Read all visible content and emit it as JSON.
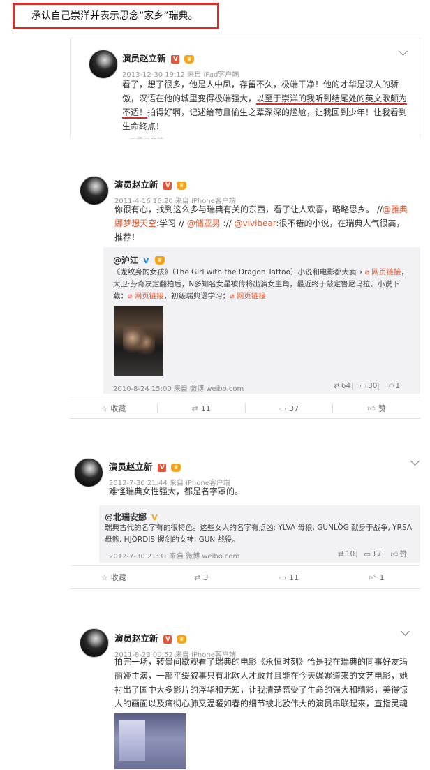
{
  "caption": "承认自己崇洋并表示思念“家乡”瑞典。",
  "icons": {
    "vip": "V",
    "crown": "vip-crown-icon",
    "verified_blue": "V",
    "chevron": "chevron-down-icon",
    "retweet": "retweet-icon",
    "comment": "comment-icon",
    "like": "like-icon",
    "star": "star-icon"
  },
  "posts": [
    {
      "name": "演员赵立新",
      "meta": "2013-12-30 19:12 来自 iPad客户端",
      "text_a": "看了，想了很多，他是人中凤，存留不久，极端干净！他的才华是汉人的骄傲，汉语在他的城里变得极端强大，",
      "text_b": "以至于崇洋的我听到结尾处的英文歌颇为不适！",
      "text_c": "拍得好啊，记述给苟且偷生之辈深深的尴尬，让我回到少年！让我看到生命终点！",
      "cutoff": "一二零四牟盹"
    },
    {
      "name": "演员赵立新",
      "meta": "2011-4-16 16:20 来自 iPhone客户端",
      "text_a": "你很有心，找到这么多与瑞典有关的东西，看了让人欢喜，略略思乡。 //",
      "mention1": "@雅典娜梦想天空",
      "text_b": ":学习 // ",
      "mention2": "@储亚男",
      "text_c": " :// ",
      "mention3": "@vivibear",
      "text_d": ":很不错的小说，在瑞典人气很高，推荐！",
      "repost": {
        "name": "@沪江",
        "text_a": "《龙纹身的女孩》（The Girl with the Dragon Tattoo）小说和电影都大卖→ ",
        "link1": "网页链接",
        "text_b": "，大卫·芬奇决定翻拍后，N多知名女星被传将出演女主角，最近终于敲定鲁尼玛拉。小说下载：",
        "link2": "网页链接",
        "text_c": "，初级瑞典语学习：",
        "link3": "网页链接",
        "footer": "2010-8-24 15:00 来自 微博 weibo.com",
        "reposts": "64",
        "comments": "30",
        "likes": "1"
      },
      "actions": {
        "fav": "收藏",
        "retweet": "11",
        "comment": "37",
        "like": "赞"
      }
    },
    {
      "name": "演员赵立新",
      "meta": "2012-7-30 21:44 来自 iPhone客户端",
      "text_a": "难怪瑞典女性强大，都是名字罩的。",
      "repost": {
        "name": "@北瑞安娜",
        "text_a": "瑞典古代的名字有的很特色。这些女人的名字有点凶: YLVA 母狼, GUNLÖG 献身于战争, YRSA 母熊, HJÖRDIS 握剑的女神, GUN 战役。",
        "footer": "2012-7-30 21:31 来自 微博 weibo.com",
        "reposts": "10",
        "comments": "17",
        "likes": "赞"
      },
      "actions": {
        "fav": "收藏",
        "retweet": "3",
        "comment": "11",
        "like": "1"
      }
    },
    {
      "name": "演员赵立新",
      "meta": "2011-8-23 00:52 来自 iPhone客户端",
      "text_a": "拍完一场，转景间歇观看了瑞典的电影《永恒时刻》恰是我在瑞典的同事好友玛丽娅主演，一部平缓叙事只有北欧人才敢并且能在今天娓娓道来的文艺电影，她衬出了国中大多影片的浮华和无知，让我清楚感受了生命的强大和精彩，美得惊人的画面以及痛彻心肺又温暖如春的细节被北欧伟大的演员串联起来，直指灵魂"
    }
  ]
}
